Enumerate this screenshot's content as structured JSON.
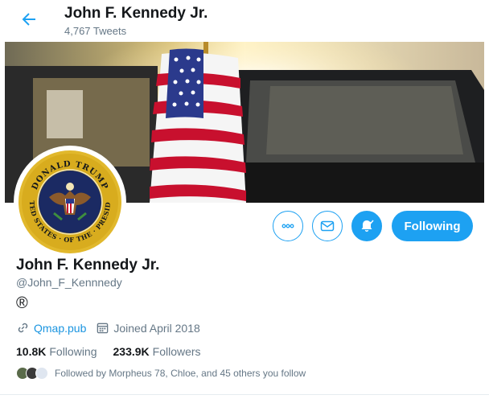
{
  "topbar": {
    "title": "John F. Kennedy Jr.",
    "tweet_count": "4,767 Tweets",
    "back_icon": "arrow-left"
  },
  "profile": {
    "name": "John F. Kennedy Jr.",
    "handle": "@John_F_Kennnedy",
    "bio": "®",
    "website": "Qmap.pub",
    "joined": "Joined April 2018",
    "following_count": "10.8K",
    "following_label": "Following",
    "followers_count": "233.9K",
    "followers_label": "Followers",
    "followed_by": "Followed by Morpheus 78, Chloe, and 45 others you follow",
    "avatar_seal_text": {
      "top": "DONALD TRUMP",
      "right": "PRESIDENT",
      "bottom": "OF THE",
      "left": "UNITED STATES"
    }
  },
  "actions": {
    "more_icon": "more-dots",
    "message_icon": "envelope",
    "notify_icon": "bell-check",
    "follow_label": "Following"
  },
  "colors": {
    "accent": "#1da1f2",
    "link": "#1b95e0",
    "muted": "#657786",
    "text": "#14171a"
  }
}
